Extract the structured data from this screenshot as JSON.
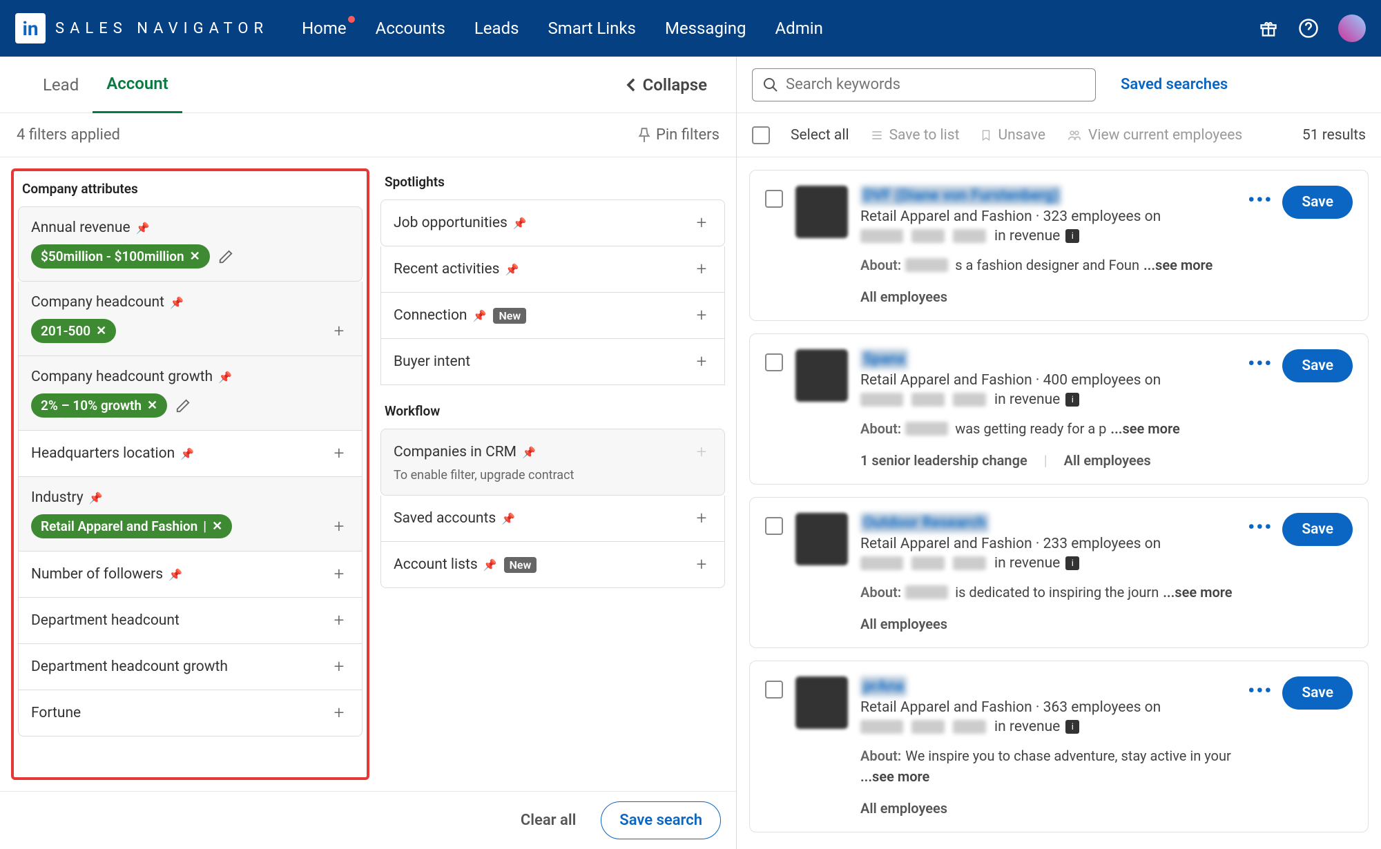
{
  "header": {
    "logo_letters": "in",
    "logo_text": "SALES NAVIGATOR",
    "nav": [
      "Home",
      "Accounts",
      "Leads",
      "Smart Links",
      "Messaging",
      "Admin"
    ]
  },
  "tabs": {
    "lead": "Lead",
    "account": "Account",
    "collapse": "Collapse"
  },
  "filters_applied_text": "4 filters applied",
  "pin_filters": "Pin filters",
  "sections": {
    "company_attributes": "Company attributes",
    "spotlights": "Spotlights",
    "workflow": "Workflow"
  },
  "filters": {
    "annual_revenue": {
      "label": "Annual revenue",
      "pill": "$50million - $100million"
    },
    "company_headcount": {
      "label": "Company headcount",
      "pill": "201-500"
    },
    "company_headcount_growth": {
      "label": "Company headcount growth",
      "pill": "2% – 10% growth"
    },
    "hq_location": {
      "label": "Headquarters location"
    },
    "industry": {
      "label": "Industry",
      "pill": "Retail Apparel and Fashion"
    },
    "followers": {
      "label": "Number of followers"
    },
    "dept_headcount": {
      "label": "Department headcount"
    },
    "dept_headcount_growth": {
      "label": "Department headcount growth"
    },
    "fortune": {
      "label": "Fortune"
    },
    "job_opportunities": {
      "label": "Job opportunities"
    },
    "recent_activities": {
      "label": "Recent activities"
    },
    "connection": {
      "label": "Connection",
      "badge": "New"
    },
    "buyer_intent": {
      "label": "Buyer intent"
    },
    "companies_in_crm": {
      "label": "Companies in CRM",
      "note": "To enable filter, upgrade contract"
    },
    "saved_accounts": {
      "label": "Saved accounts"
    },
    "account_lists": {
      "label": "Account lists",
      "badge": "New"
    }
  },
  "filter_footer": {
    "clear": "Clear all",
    "save": "Save search"
  },
  "search": {
    "placeholder": "Search keywords",
    "saved": "Saved searches"
  },
  "toolbar": {
    "select_all": "Select all",
    "save_to_list": "Save to list",
    "unsave": "Unsave",
    "view_employees": "View current employees",
    "results": "51 results"
  },
  "results": [
    {
      "name": "DVF (Diane von Furstenberg)",
      "meta": "Retail Apparel and Fashion · 323 employees on",
      "revenue_tail": "in revenue",
      "about_tail": "s a fashion designer and Foun",
      "footer": [
        "All employees"
      ]
    },
    {
      "name": "Spanx",
      "meta": "Retail Apparel and Fashion · 400 employees on",
      "revenue_tail": "in revenue",
      "about_tail": "was getting ready for a p",
      "footer": [
        "1 senior leadership change",
        "All employees"
      ]
    },
    {
      "name": "Outdoor Research",
      "meta": "Retail Apparel and Fashion · 233 employees on",
      "revenue_tail": "in revenue",
      "about_tail": "is dedicated to inspiring the journ",
      "footer": [
        "All employees"
      ]
    },
    {
      "name": "prAna",
      "meta": "Retail Apparel and Fashion · 363 employees on",
      "revenue_tail": "in revenue",
      "about_plain": "We inspire you to chase adventure, stay active in your ",
      "footer": [
        "All employees"
      ]
    }
  ],
  "common": {
    "about": "About:",
    "see_more": "...see more",
    "save": "Save"
  }
}
